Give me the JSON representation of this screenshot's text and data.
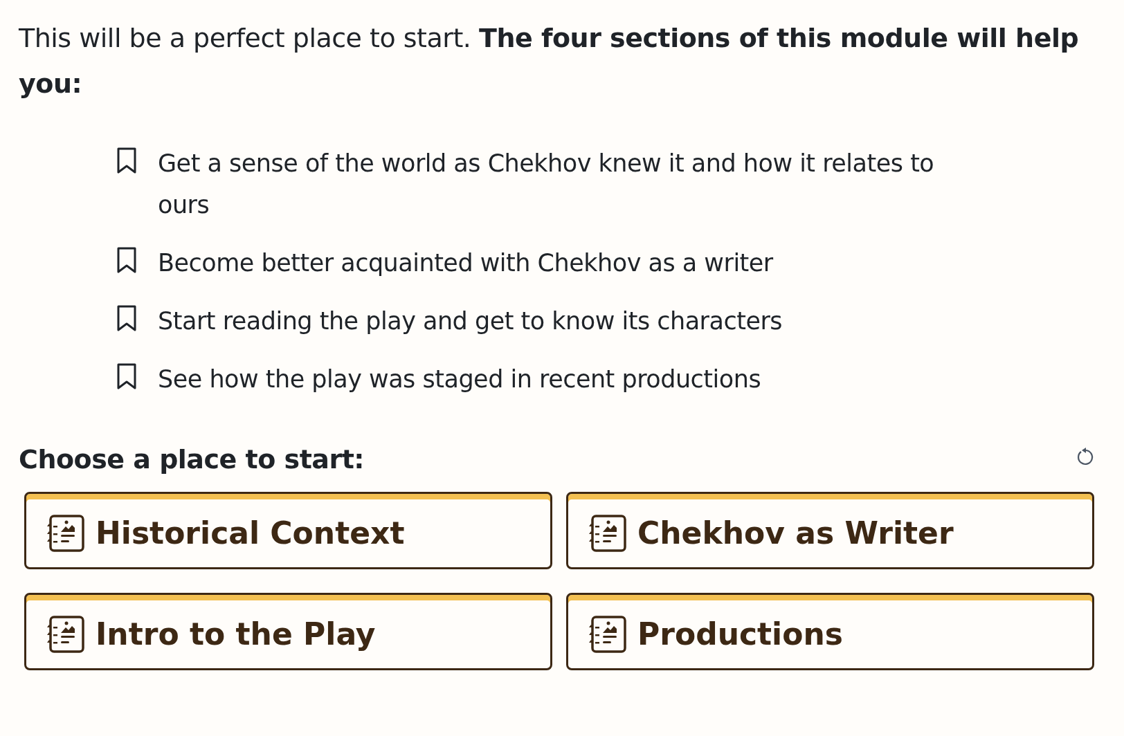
{
  "intro": "This will be a perfect place to start. **The four sections of this module will help you:**",
  "goals": [
    "Get a sense of the world as Chekhov knew it and how it relates to ours",
    "Become better acquainted with Chekhov as a writer",
    "Start reading the play and get to know its characters",
    "See how the play was staged in recent productions"
  ],
  "choose_heading": "Choose a place to start:",
  "sections": [
    "Historical Context",
    "Chekhov as Writer",
    "Intro to the Play",
    "Productions"
  ]
}
